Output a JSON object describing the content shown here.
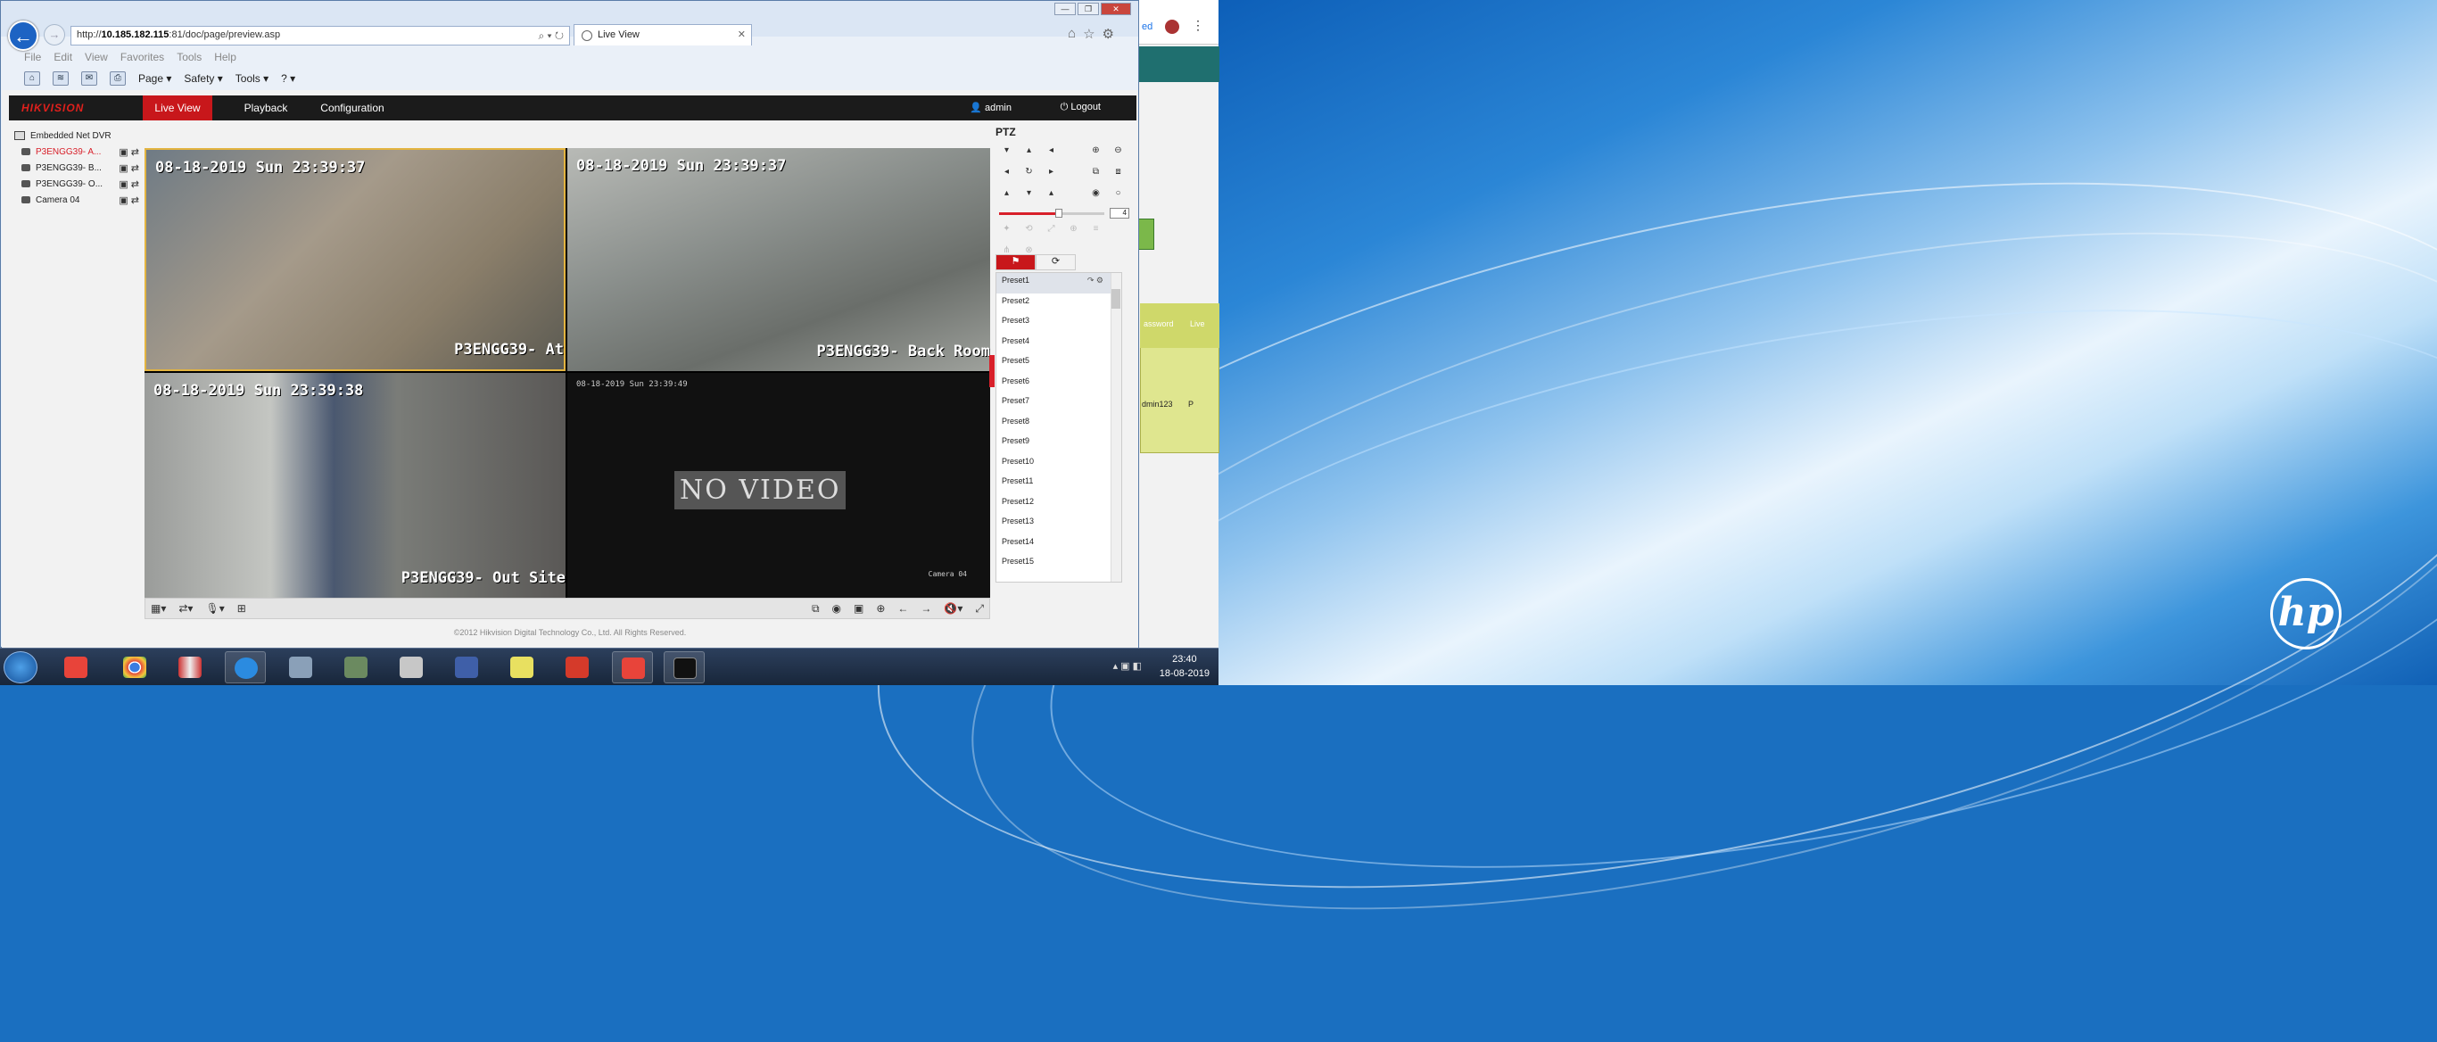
{
  "browser": {
    "url_prefix": "http://",
    "url_host": "10.185.182.115",
    "url_path": ":81/doc/page/preview.asp",
    "tab_title": "Live View",
    "menu": [
      "File",
      "Edit",
      "View",
      "Favorites",
      "Tools",
      "Help"
    ],
    "cmd": {
      "page": "Page ▾",
      "safety": "Safety ▾",
      "tools": "Tools ▾",
      "help": "? ▾"
    }
  },
  "app": {
    "logo": "HIKVISION",
    "nav": [
      "Live View",
      "Playback",
      "Configuration"
    ],
    "user": "admin",
    "logout": "Logout",
    "copyright": "©2012 Hikvision Digital Technology Co., Ltd. All Rights Reserved."
  },
  "tree": {
    "root": "Embedded Net DVR",
    "cameras": [
      "P3ENGG39- A...",
      "P3ENGG39- B...",
      "P3ENGG39- O...",
      "Camera 04"
    ]
  },
  "video": {
    "cam1": {
      "ts": "08-18-2019 Sun 23:39:37",
      "name": "P3ENGG39- At"
    },
    "cam2": {
      "ts": "08-18-2019 Sun 23:39:37",
      "name": "P3ENGG39- Back Room"
    },
    "cam3": {
      "ts": "08-18-2019 Sun 23:39:38",
      "name": "P3ENGG39- Out Site"
    },
    "cam4": {
      "ts": "08-18-2019 Sun 23:39:49",
      "novideo": "NO VIDEO",
      "name": "Camera 04"
    }
  },
  "ptz": {
    "title": "PTZ",
    "speed": "4",
    "speed_fraction": 0.57,
    "presets": [
      "Preset1",
      "Preset2",
      "Preset3",
      "Preset4",
      "Preset5",
      "Preset6",
      "Preset7",
      "Preset8",
      "Preset9",
      "Preset10",
      "Preset11",
      "Preset12",
      "Preset13",
      "Preset14",
      "Preset15"
    ]
  },
  "taskbar": {
    "time": "23:40",
    "date": "18-08-2019"
  },
  "colors": {
    "accent": "#c8171b",
    "nav_bg": "#1b1b1b"
  }
}
